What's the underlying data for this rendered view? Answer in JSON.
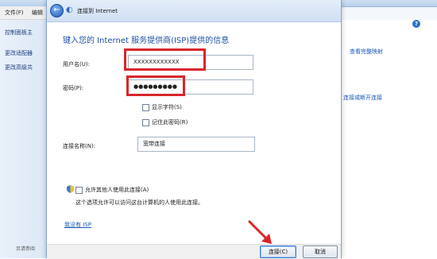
{
  "background_window": {
    "menu": [
      "文件(F)",
      "编辑"
    ],
    "sidebar_links": [
      "控制面板主",
      "更改适配器",
      "更改高级共"
    ],
    "right_links": [
      "查看完整映射",
      "连接或断开连接"
    ],
    "see_also": "另请参阅",
    "help_icon": "?"
  },
  "dialog": {
    "title": "连接到 Internet",
    "heading": "键入您的 Internet 服务提供商(ISP)提供的信息",
    "username_label": "用户名(U):",
    "username_value": "XXXXXXXXXXXX",
    "password_label": "密码(P):",
    "password_value": "●●●●●●●●●",
    "show_chars_label": "显示字符(S)",
    "remember_pw_label": "记住此密码(R)",
    "conn_name_label": "连接名称(N):",
    "conn_name_value": "宽带连接",
    "allow_others_label": "允许其他人使用此连接(A)",
    "allow_others_desc": "这个选项允许可以访问这台计算机的人使用此连接。",
    "no_isp_link": "我没有 ISP",
    "connect_button": "连接(C)",
    "cancel_button": "取消"
  },
  "colors": {
    "highlight": "#d8262b",
    "link": "#1a56b8",
    "heading": "#1f4fa8"
  }
}
